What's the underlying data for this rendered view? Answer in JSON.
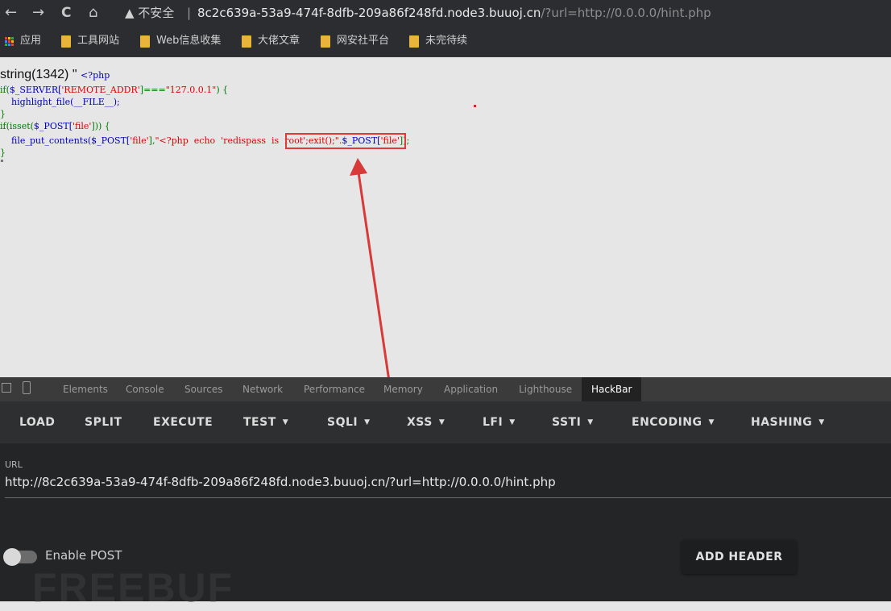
{
  "browser": {
    "nav": {
      "back": "←",
      "forward": "→",
      "reload": "C",
      "home": "⌂"
    },
    "security_warning": "▲ 不安全",
    "separator": "|",
    "url_host": "8c2c639a-53a9-474f-8dfb-209a86f248fd.node3.buuoj.cn",
    "url_path": "/?url=http://0.0.0.0/hint.php"
  },
  "bookmarks": {
    "apps": "应用",
    "items": [
      "工具网站",
      "Web信息收集",
      "大佬文章",
      "网安社平台",
      "未完待续"
    ]
  },
  "page": {
    "line1_prefix": "string(1342) \" ",
    "line1_tag": "<?php",
    "line2_if": "if(",
    "line2_var": "$_SERVER[",
    "line2_key": "'REMOTE_ADDR'",
    "line2_mid": "]===",
    "line2_val": "\"127.0.0.1\"",
    "line2_end": ") {",
    "line3": "    highlight_file(__FILE__);",
    "line4": "}",
    "line5_a": "if(isset(",
    "line5_b": "$_POST[",
    "line5_c": "'file'",
    "line5_d": "])) {",
    "line6_a": "    file_put_contents(",
    "line6_b": "$_POST[",
    "line6_c": "'file'",
    "line6_d": "],",
    "line6_e": "\"<?php  echo  'redispass  is  root';exit();\".",
    "line6_f": "$_POST[",
    "line6_g": "'file'",
    "line6_h": "]);",
    "line7": "}",
    "line8": "\"",
    "highlight_color": "#e03a3a"
  },
  "devtools": {
    "tabs": [
      "Elements",
      "Console",
      "Sources",
      "Network",
      "Performance",
      "Memory",
      "Application",
      "Lighthouse",
      "HackBar"
    ],
    "active_tab": "HackBar"
  },
  "hackbar": {
    "buttons": [
      "LOAD",
      "SPLIT",
      "EXECUTE",
      "TEST",
      "SQLI",
      "XSS",
      "LFI",
      "SSTI",
      "ENCODING",
      "HASHING"
    ],
    "url_label": "URL",
    "url_value": "http://8c2c639a-53a9-474f-8dfb-209a86f248fd.node3.buuoj.cn/?url=http://0.0.0.0/hint.php",
    "enable_post_label": "Enable POST",
    "enable_post_on": false,
    "add_header_label": "ADD HEADER"
  },
  "watermark": "FREEBUF"
}
